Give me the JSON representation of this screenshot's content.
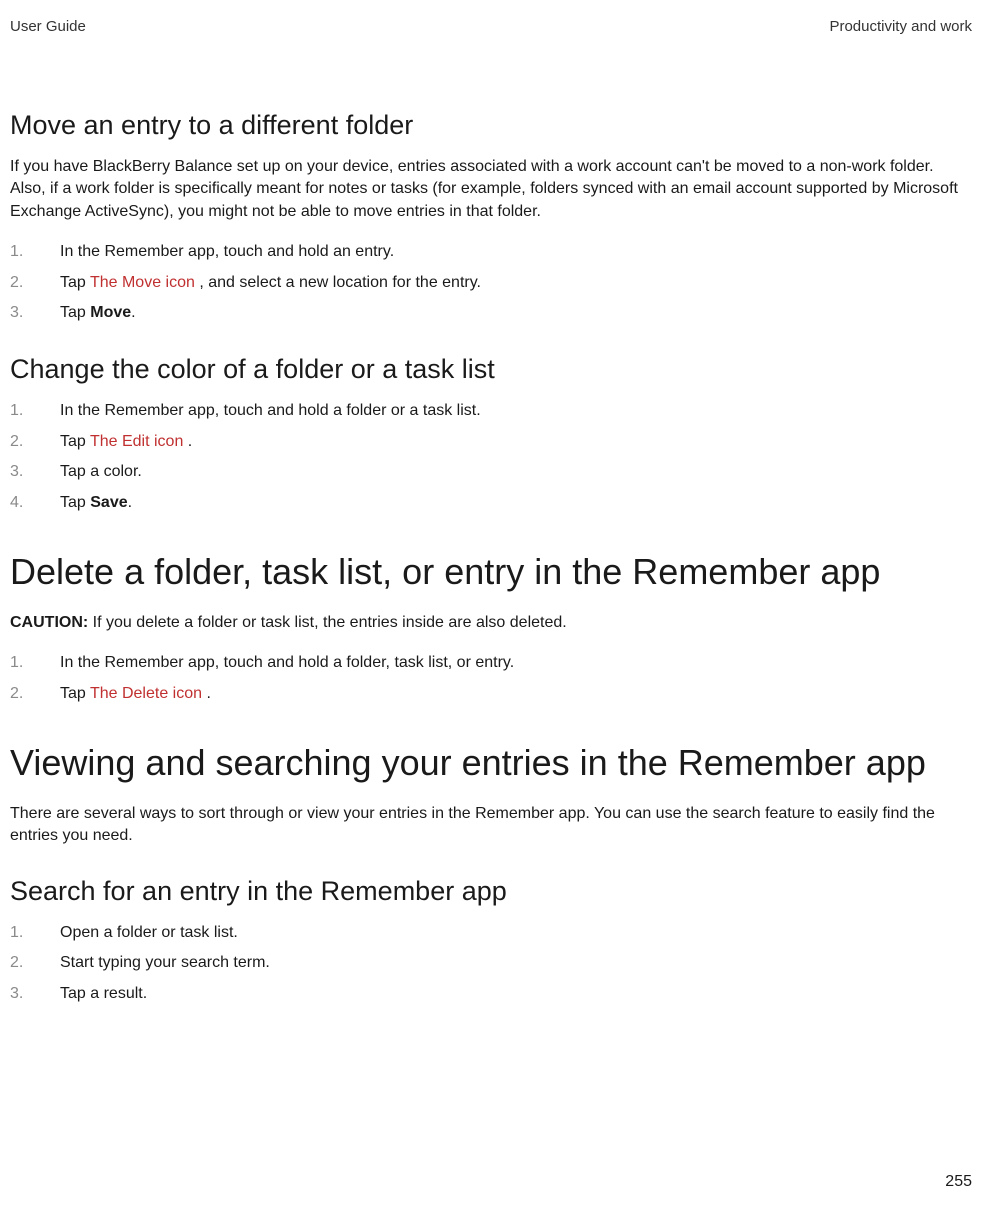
{
  "header": {
    "left": "User Guide",
    "right": "Productivity and work"
  },
  "section1": {
    "title": "Move an entry to a different folder",
    "intro": "If you have BlackBerry Balance set up on your device, entries associated with a work account can't be moved to a non-work folder. Also, if a work folder is specifically meant for notes or tasks (for example, folders synced with an email account supported by Microsoft Exchange ActiveSync), you might not be able to move entries in that folder.",
    "step1": "In the Remember app, touch and hold an entry.",
    "step2_prefix": "Tap  ",
    "step2_icon": "The Move icon ",
    "step2_suffix": ", and select a new location for the entry.",
    "step3_prefix": "Tap ",
    "step3_bold": "Move",
    "step3_suffix": "."
  },
  "section2": {
    "title": "Change the color of a folder or a task list",
    "step1": "In the Remember app, touch and hold a folder or a task list.",
    "step2_prefix": "Tap  ",
    "step2_icon": "The Edit icon ",
    "step2_suffix": ".",
    "step3": "Tap a color.",
    "step4_prefix": "Tap ",
    "step4_bold": "Save",
    "step4_suffix": "."
  },
  "section3": {
    "title": "Delete a folder, task list, or entry in the Remember app",
    "caution_label": "CAUTION: ",
    "caution_text": "If you delete a folder or task list, the entries inside are also deleted.",
    "step1": "In the Remember app, touch and hold a folder, task list, or entry.",
    "step2_prefix": "Tap  ",
    "step2_icon": "The Delete icon ",
    "step2_suffix": "."
  },
  "section4": {
    "title": "Viewing and searching your entries in the Remember app",
    "intro": "There are several ways to sort through or view your entries in the Remember app. You can use the search feature to easily find the entries you need."
  },
  "section5": {
    "title": "Search for an entry in the Remember app",
    "step1": "Open a folder or task list.",
    "step2": "Start typing your search term.",
    "step3": "Tap a result."
  },
  "page_number": "255"
}
